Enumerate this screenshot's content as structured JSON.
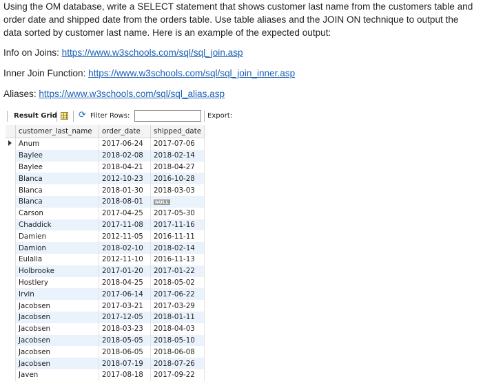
{
  "intro_text": "Using the OM database, write a SELECT statement that shows customer last name from the customers table and order date and shipped date from the orders table. Use table aliases and the JOIN ON technique to output the data sorted by customer last name.  Here is an example of the expected output:",
  "links": [
    {
      "label": "Info on Joins: ",
      "url_text": "https://www.w3schools.com/sql/sql_join.asp"
    },
    {
      "label": "Inner Join Function: ",
      "url_text": "https://www.w3schools.com/sql/sql_join_inner.asp"
    },
    {
      "label": "Aliases: ",
      "url_text": "https://www.w3schools.com/sql/sql_alias.asp"
    }
  ],
  "toolbar": {
    "title": "Result Grid",
    "filter_label": "Filter Rows:",
    "filter_value": "",
    "export_label": "Export:"
  },
  "grid": {
    "columns": [
      "customer_last_name",
      "order_date",
      "shipped_date"
    ],
    "rows": [
      [
        "Anum",
        "2017-06-24",
        "2017-07-06"
      ],
      [
        "Baylee",
        "2018-02-08",
        "2018-02-14"
      ],
      [
        "Baylee",
        "2018-04-21",
        "2018-04-27"
      ],
      [
        "Blanca",
        "2012-10-23",
        "2016-10-28"
      ],
      [
        "Blanca",
        "2018-01-30",
        "2018-03-03"
      ],
      [
        "Blanca",
        "2018-08-01",
        "NULL"
      ],
      [
        "Carson",
        "2017-04-25",
        "2017-05-30"
      ],
      [
        "Chaddick",
        "2017-11-08",
        "2017-11-16"
      ],
      [
        "Damien",
        "2012-11-05",
        "2016-11-11"
      ],
      [
        "Damion",
        "2018-02-10",
        "2018-02-14"
      ],
      [
        "Eulalia",
        "2012-11-10",
        "2016-11-13"
      ],
      [
        "Holbrooke",
        "2017-01-20",
        "2017-01-22"
      ],
      [
        "Hostlery",
        "2018-04-25",
        "2018-05-02"
      ],
      [
        "Irvin",
        "2017-06-14",
        "2017-06-22"
      ],
      [
        "Jacobsen",
        "2017-03-21",
        "2017-03-29"
      ],
      [
        "Jacobsen",
        "2017-12-05",
        "2018-01-11"
      ],
      [
        "Jacobsen",
        "2018-03-23",
        "2018-04-03"
      ],
      [
        "Jacobsen",
        "2018-05-05",
        "2018-05-10"
      ],
      [
        "Jacobsen",
        "2018-06-05",
        "2018-06-08"
      ],
      [
        "Jacobsen",
        "2018-07-19",
        "2018-07-26"
      ],
      [
        "Javen",
        "2017-08-18",
        "2017-09-22"
      ]
    ]
  }
}
